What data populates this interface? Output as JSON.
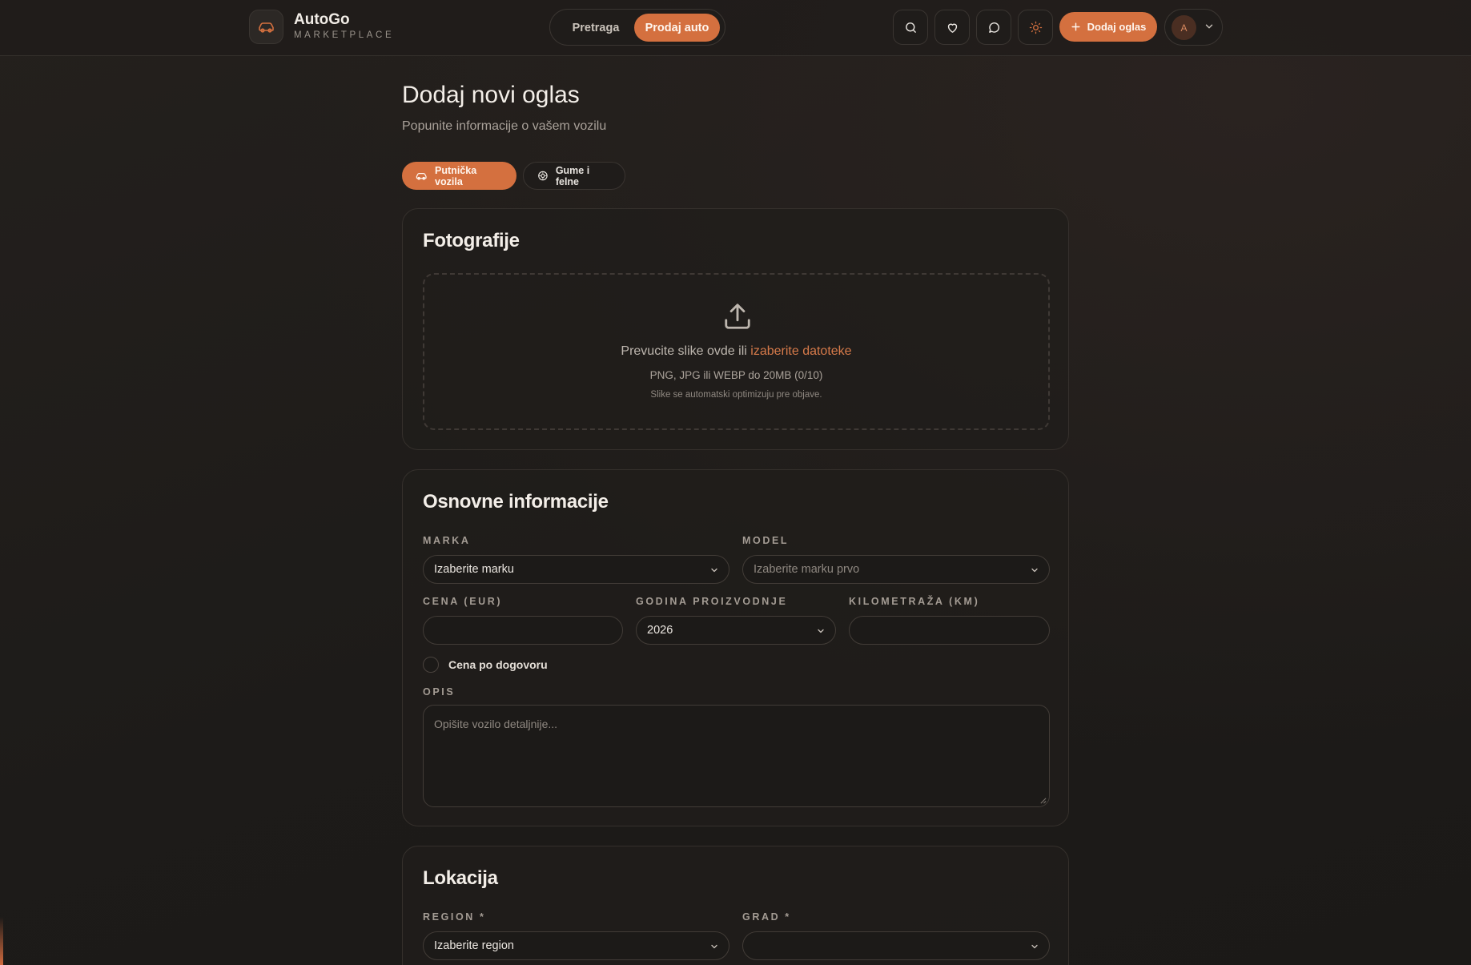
{
  "header": {
    "app_name": "AutoGo",
    "app_tagline": "MARKETPLACE",
    "nav": {
      "search_label": "Pretraga",
      "sell_label": "Prodaj auto"
    },
    "add_ad_label": "Dodaj oglas",
    "avatar_initial": "A",
    "icons": [
      "car-icon",
      "search-icon",
      "heart-icon",
      "chat-icon",
      "sun-icon",
      "plus-icon",
      "chevron-down-icon"
    ]
  },
  "page": {
    "title": "Dodaj novi oglas",
    "subtitle": "Popunite informacije o vašem vozilu"
  },
  "categories": {
    "active": "Putnička vozila",
    "other": "Gume i felne"
  },
  "photos": {
    "title": "Fotografije",
    "drop_text": "Prevucite slike ovde ili",
    "drop_link": "izaberite datoteke",
    "hint": "PNG, JPG ili WEBP do 20MB (0/10)",
    "note": "Slike se automatski optimizuju pre objave."
  },
  "basic_info": {
    "title": "Osnovne informacije",
    "brand_label": "MARKA",
    "brand_value": "Izaberite marku",
    "model_label": "MODEL",
    "model_placeholder": "Izaberite marku prvo",
    "price_label": "CENA (EUR)",
    "price_value": "",
    "year_label": "GODINA PROIZVODNJE",
    "year_value": "2026",
    "mileage_label": "KILOMETRAŽA (KM)",
    "mileage_value": "",
    "negotiable_label": "Cena po dogovoru",
    "negotiable_checked": false,
    "description_label": "OPIS",
    "description_placeholder": "Opišite vozilo detaljnije..."
  },
  "location": {
    "title": "Lokacija",
    "region_label": "REGION *",
    "region_value": "Izaberite region",
    "city_label": "GRAD *",
    "city_value": ""
  },
  "colors": {
    "accent": "#d4703f",
    "background": "#201d1b",
    "card_border": "#35302c"
  }
}
